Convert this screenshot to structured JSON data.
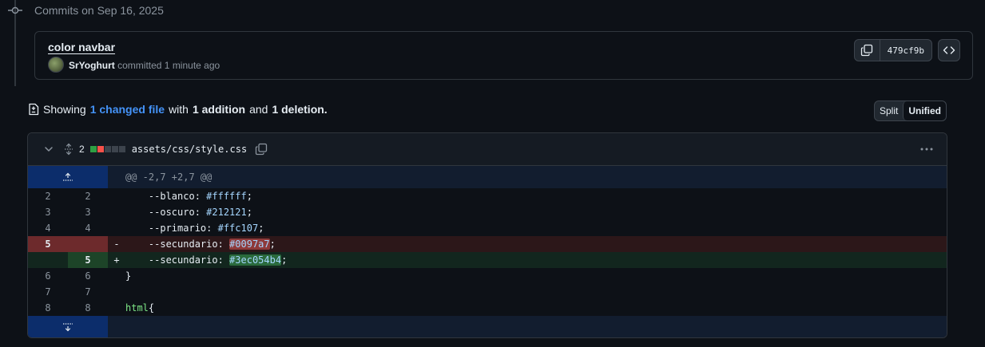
{
  "timeline": {
    "header": "Commits on Sep 16, 2025"
  },
  "commit": {
    "title": "color navbar",
    "author": "SrYoghurt",
    "meta": "committed 1 minute ago",
    "sha": "479cf9b"
  },
  "summary": {
    "prefix": "Showing",
    "link": "1 changed file",
    "with": "with",
    "additions": "1 addition",
    "and": "and",
    "deletions": "1 deletion."
  },
  "view_toggle": {
    "split": "Split",
    "unified": "Unified",
    "selected": "Unified"
  },
  "file": {
    "change_count": "2",
    "path": "assets/css/style.css",
    "diffstat_colors": [
      "#2ea043",
      "#f85149",
      "#3d444d",
      "#3d444d",
      "#3d444d"
    ]
  },
  "diff": {
    "hunk_header": "@@ -2,7 +2,7 @@",
    "lines": [
      {
        "type": "context",
        "old": "2",
        "new": "2",
        "marker": "",
        "indent": "    ",
        "prop": "--blanco",
        "value": "#ffffff",
        "end": ";"
      },
      {
        "type": "context",
        "old": "3",
        "new": "3",
        "marker": "",
        "indent": "    ",
        "prop": "--oscuro",
        "value": "#212121",
        "end": ";"
      },
      {
        "type": "context",
        "old": "4",
        "new": "4",
        "marker": "",
        "indent": "    ",
        "prop": "--primario",
        "value": "#ffc107",
        "end": ";"
      },
      {
        "type": "del",
        "old": "5",
        "new": "",
        "marker": "-",
        "indent": "    ",
        "prop": "--secundario",
        "value": "#0097a7",
        "end": ";"
      },
      {
        "type": "add",
        "old": "",
        "new": "5",
        "marker": "+",
        "indent": "    ",
        "prop": "--secundario",
        "value": "#3ec054b4",
        "end": ";"
      },
      {
        "type": "context",
        "old": "6",
        "new": "6",
        "marker": "",
        "text": "}"
      },
      {
        "type": "context",
        "old": "7",
        "new": "7",
        "marker": "",
        "text": ""
      },
      {
        "type": "context",
        "old": "8",
        "new": "8",
        "marker": "",
        "selector": "html",
        "text_after": "{"
      }
    ]
  },
  "colors": {
    "background": "#0d1117",
    "accent_link": "#4493f8",
    "deletion_bg": "#2c1719",
    "addition_bg": "#12261e",
    "hunk_gutter": "#0c2d6b"
  },
  "icons": [
    "git-commit-icon",
    "copy-icon",
    "code-icon",
    "file-diff-icon",
    "chevron-down-icon",
    "unfold-icon",
    "copy-path-icon",
    "kebab-icon",
    "expand-up-icon",
    "expand-down-icon"
  ]
}
